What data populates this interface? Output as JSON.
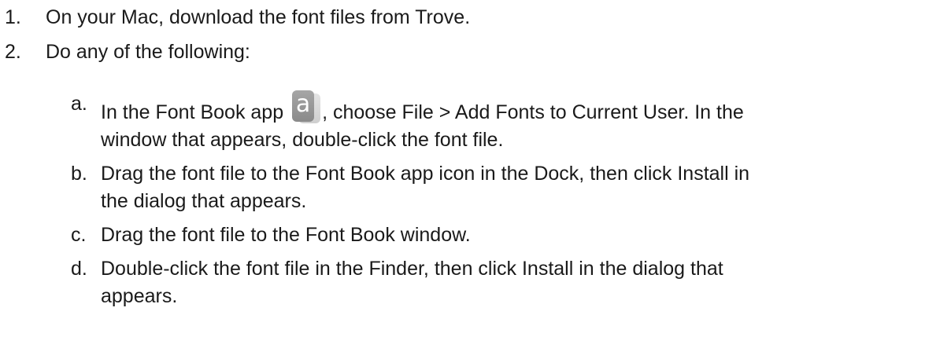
{
  "steps": [
    {
      "number": "1.",
      "text": "On your Mac, download the font files from Trove."
    },
    {
      "number": "2.",
      "text": "Do any of the following:"
    }
  ],
  "options": {
    "a": {
      "letter": "a.",
      "line1_before": "In the Font Book app ",
      "icon": {
        "name": "font-book-app-icon",
        "glyph": "a"
      },
      "line1_after": ", choose File > Add Fonts to Current User. In the",
      "line2": "window that appears, double-click the font file."
    },
    "b": {
      "letter": "b.",
      "line1": "Drag the font file to the Font Book app icon in the Dock, then click Install in",
      "line2": "the dialog that appears."
    },
    "c": {
      "letter": "c.",
      "line1": "Drag the font file to the Font Book window."
    },
    "d": {
      "letter": "d.",
      "line1": "Double-click the font file in the Finder, then click Install in the dialog that",
      "line2": "appears."
    }
  }
}
